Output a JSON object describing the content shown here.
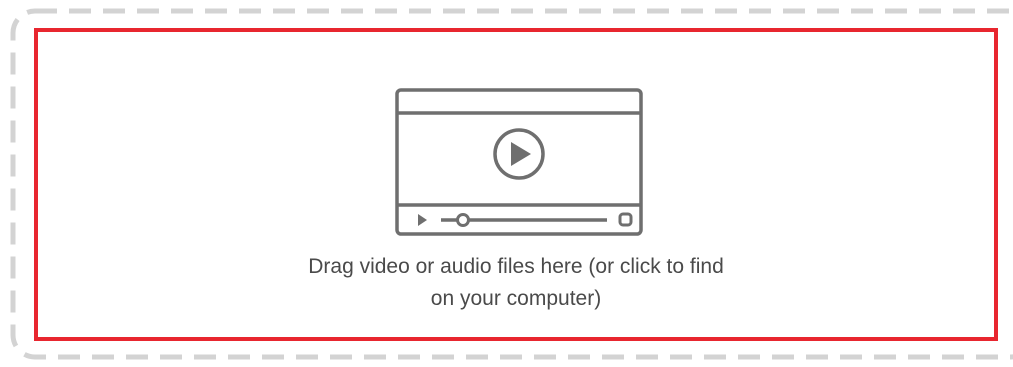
{
  "dropzone": {
    "line1": "Drag video or audio files here (or click to find",
    "line2": "on your computer)",
    "icon": "video-player-icon",
    "colors": {
      "highlight_border": "#e8262f",
      "dashed_border": "#d3d3d3",
      "icon_stroke": "#6f6f6f",
      "text": "#4a4a4a"
    }
  }
}
